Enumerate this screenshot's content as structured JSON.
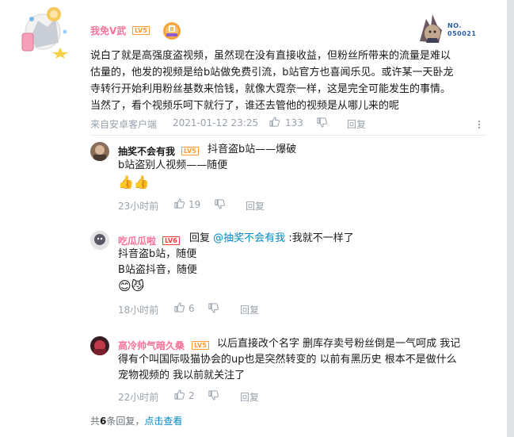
{
  "main_comment": {
    "username": "我免V武",
    "level": "LV5",
    "fan_badge_no_top": "NO.",
    "fan_badge_no": "050021",
    "lines": [
      "说白了就是高强度盗视频，虽然现在没有直接收益，但粉丝所带来的流量是难以",
      "估量的，他发的视频是给b站做免费引流，b站官方也喜闻乐见。或许某一天卧龙",
      "寺转行开始利用粉丝基数来恰钱，就像大霓奈一样，这是完全可能发生的事情。",
      "当然了，看个视频乐呵下就行了，谁还去管他的视频是从哪儿来的呢"
    ],
    "source": "来自安卓客户端",
    "time": "2021-01-12 23:25",
    "likes": "133",
    "reply_label": "回复"
  },
  "replies": [
    {
      "username": "抽奖不会有我",
      "level": "LV5",
      "line1": "抖音盗b站——爆破",
      "line2": "b站盗别人视频——随便",
      "emojis": "👍👍",
      "time": "23小时前",
      "likes": "19",
      "reply_label": "回复"
    },
    {
      "username": "吃瓜瓜啦",
      "level": "LV6",
      "prefix": "回复",
      "mention": "@抽奖不会有我",
      "line1_rest": ":我就不一样了",
      "line2": "抖音盗b站，随便",
      "line3": "B站盗抖音，随便",
      "emojis": "😊😼",
      "time": "18小时前",
      "likes": "6",
      "reply_label": "回复"
    },
    {
      "username": "高冷帅气暗久桑",
      "level": "LV5",
      "line1": "以后直接改个名字 删库存卖号粉丝倒是一气呵成 我记",
      "line2": "得有个叫国际吸猫协会的up也是突然转变的 以前有黑历史 根本不是做什么",
      "line3": "宠物视频的 我以前就关注了",
      "time": "22小时前",
      "likes": "2",
      "reply_label": "回复"
    }
  ],
  "footer": {
    "total_prefix": "共",
    "total_count": "6",
    "total_suffix": "条回复，",
    "view_link": "点击查看"
  },
  "colors": {
    "vip_name": "#fb7299",
    "normal_name": "#18191c",
    "meta": "#99a2aa",
    "link": "#008ac5",
    "level5": "#ff9a30",
    "level6": "#ff3b3b"
  },
  "icons": [
    "avatar-frame",
    "medal-badge",
    "fan-card-badge",
    "thumb-up-icon",
    "thumb-down-icon",
    "more-options-icon"
  ]
}
